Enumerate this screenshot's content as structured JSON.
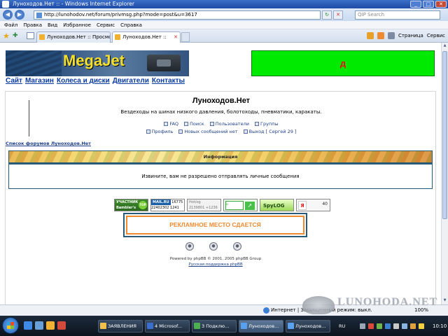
{
  "window": {
    "title": "Луноходов.Нет :: - Windows Internet Explorer",
    "buttons": [
      "_",
      "□",
      "✕"
    ]
  },
  "address_bar": {
    "url": "http://lunohodov.net/forum/privmsg.php?mode=post&u=3617",
    "search_placeholder": "QIP Search"
  },
  "menu": [
    "Файл",
    "Правка",
    "Вид",
    "Избранное",
    "Сервис",
    "Справка"
  ],
  "tabs": [
    {
      "label": "Луноходов.Нет :: Просмо...",
      "active": false
    },
    {
      "label": "Луноходов.Нет ::",
      "active": true
    }
  ],
  "command_bar": {
    "page": "Страница",
    "tools": "Сервис"
  },
  "banners": {
    "megajet": "MegaJet",
    "green": "д"
  },
  "top_links": [
    "Сайт",
    "Магазин",
    "Колеса и диски",
    "Двигатели",
    "Контакты"
  ],
  "forum": {
    "title": "Луноходов.Нет",
    "description": "Вездеходы на шинах низкого давления, болотоходы, пневматики, каракаты.",
    "nav_row1": [
      "FAQ",
      "Поиск",
      "Пользователи",
      "Группы"
    ],
    "nav_row2": [
      "Профиль",
      "Новых сообщений нет",
      "Выход [ Сергей 29 ]"
    ],
    "index_link": "Список форумов Луноходов.Нет"
  },
  "info": {
    "header": "Информация",
    "message": "Извините, вам не разрешено отправлять личные сообщения"
  },
  "counters": {
    "bambler_label": "УЧАСТНИК",
    "bambler_name": "Bambler's",
    "bambler_badge": "TOP 100",
    "mailru_label": "MAIL.RU",
    "mailru_num1": "16775",
    "mailru_num2": "22402302",
    "mailru_num3": "1241",
    "hotlog_label": "Hot/og",
    "hotlog_num1": "2139801",
    "hotlog_num2": "+1236",
    "liveinternet_label": "LI",
    "spylog_label": "SpyLOG",
    "yandex_label": "Я",
    "yandex_value": "40"
  },
  "ad": {
    "text": "РЕКЛАМНОЕ МЕСТО СДАЕТСЯ"
  },
  "footer": {
    "powered": "Powered by phpBB © 2001, 2005 phpBB Group",
    "support": "Русская поддержка phpBB"
  },
  "status_bar": {
    "zone": "Интернет | Защищенный режим: выкл.",
    "zoom": "100%"
  },
  "watermark": "LUNOHODA.NET",
  "taskbar": {
    "buttons": [
      {
        "label": "ЗАЯВЛЕНИЯ",
        "active": false
      },
      {
        "label": "4 Microsof...",
        "active": false
      },
      {
        "label": "3 Подклю...",
        "active": false
      },
      {
        "label": "Луноходов...",
        "active": true
      },
      {
        "label": "Луноходов...",
        "active": false
      }
    ],
    "language": "RU",
    "clock": "10:10"
  },
  "colors": {
    "accent_link": "#1d3f8a",
    "info_border": "#2a5a7a",
    "ad_orange": "#f08a30",
    "green_banner": "#00ea00",
    "megajet_yellow": "#f4e02c"
  }
}
